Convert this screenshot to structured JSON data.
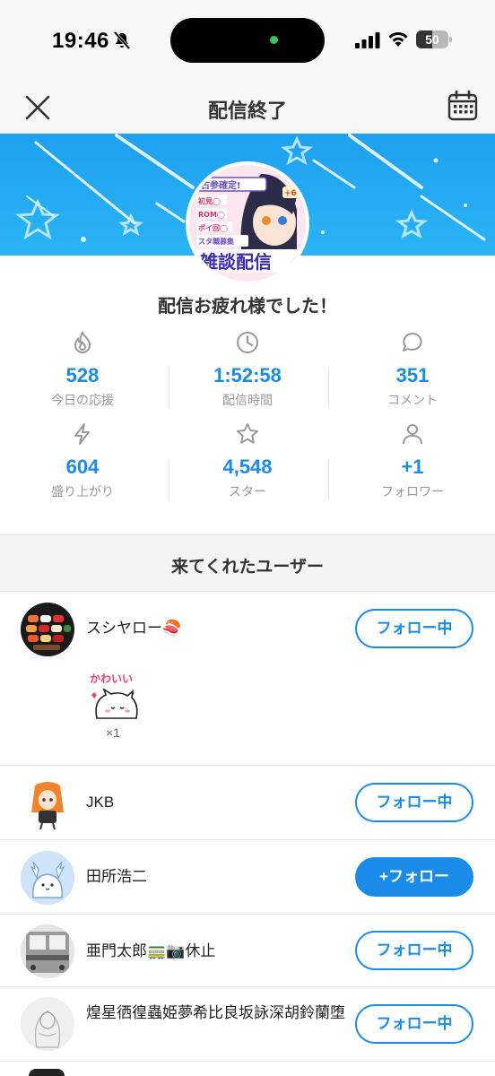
{
  "status_bar": {
    "time": "19:46",
    "battery": "50",
    "battery_level": 0.5
  },
  "nav": {
    "title": "配信終了"
  },
  "banner": {
    "thumbnail_text": [
      "古参確定!",
      "初見◯",
      "ROM◯",
      "ポイ回◯",
      "スタ職募集",
      "雑談配信",
      "+6"
    ]
  },
  "thanks": "配信お疲れ様でした！",
  "stats": [
    {
      "icon": "flame-icon",
      "value": "528",
      "label": "今日の応援"
    },
    {
      "icon": "clock-icon",
      "value": "1:52:58",
      "label": "配信時間"
    },
    {
      "icon": "comment-icon",
      "value": "351",
      "label": "コメント"
    },
    {
      "icon": "lightning-icon",
      "value": "604",
      "label": "盛り上がり"
    },
    {
      "icon": "star-icon",
      "value": "4,548",
      "label": "スター"
    },
    {
      "icon": "person-icon",
      "value": "+1",
      "label": "フォロワー"
    }
  ],
  "section_title": "来てくれたユーザー",
  "users": [
    {
      "name": "スシヤロー🍣",
      "button": "フォロー中",
      "following": true,
      "gift": {
        "text": "かわいい",
        "count": "×1"
      }
    },
    {
      "name": "JKB",
      "button": "フォロー中",
      "following": true
    },
    {
      "name": "田所浩二",
      "button": "+フォロー",
      "following": false
    },
    {
      "name": "亜門太郎🚃📷休止",
      "button": "フォロー中",
      "following": true
    },
    {
      "name": "煌星徆徨蟲姫夢希比良坂詠深胡鈴蘭堕",
      "button": "フォロー中",
      "following": true
    }
  ],
  "colors": {
    "accent": "#1a8be8",
    "banner": "#22a8f2"
  }
}
